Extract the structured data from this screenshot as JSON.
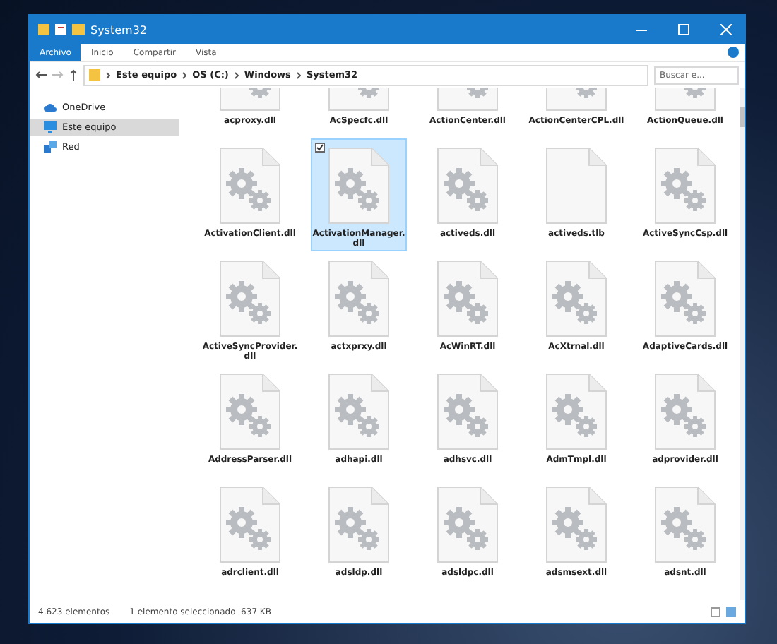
{
  "window": {
    "title": "System32"
  },
  "ribbon_tabs": [
    {
      "label": "Archivo",
      "selected": true
    },
    {
      "label": "Inicio",
      "selected": false
    },
    {
      "label": "Compartir",
      "selected": false
    },
    {
      "label": "Vista",
      "selected": false
    }
  ],
  "breadcrumb": [
    "Este equipo",
    "OS (C:)",
    "Windows",
    "System32"
  ],
  "search": {
    "placeholder": "Buscar e..."
  },
  "sidebar": {
    "items": [
      {
        "label": "OneDrive",
        "kind": "cloud",
        "selected": false
      },
      {
        "label": "Este equipo",
        "kind": "pc",
        "selected": true
      },
      {
        "label": "Red",
        "kind": "network",
        "selected": false
      }
    ]
  },
  "files": [
    {
      "name": "acproxy.dll",
      "kind": "gear",
      "selected": false
    },
    {
      "name": "AcSpecfc.dll",
      "kind": "gear",
      "selected": false
    },
    {
      "name": "ActionCenter.dll",
      "kind": "gear",
      "selected": false
    },
    {
      "name": "ActionCenterCPL.dll",
      "kind": "gear",
      "selected": false
    },
    {
      "name": "ActionQueue.dll",
      "kind": "gear",
      "selected": false
    },
    {
      "name": "ActivationClient.dll",
      "kind": "gear",
      "selected": false
    },
    {
      "name": "ActivationManager.dll",
      "kind": "gear",
      "selected": true
    },
    {
      "name": "activeds.dll",
      "kind": "gear",
      "selected": false
    },
    {
      "name": "activeds.tlb",
      "kind": "blank",
      "selected": false
    },
    {
      "name": "ActiveSyncCsp.dll",
      "kind": "gear",
      "selected": false
    },
    {
      "name": "ActiveSyncProvider.dll",
      "kind": "gear",
      "selected": false
    },
    {
      "name": "actxprxy.dll",
      "kind": "gear",
      "selected": false
    },
    {
      "name": "AcWinRT.dll",
      "kind": "gear",
      "selected": false
    },
    {
      "name": "AcXtrnal.dll",
      "kind": "gear",
      "selected": false
    },
    {
      "name": "AdaptiveCards.dll",
      "kind": "gear",
      "selected": false
    },
    {
      "name": "AddressParser.dll",
      "kind": "gear",
      "selected": false
    },
    {
      "name": "adhapi.dll",
      "kind": "gear",
      "selected": false
    },
    {
      "name": "adhsvc.dll",
      "kind": "gear",
      "selected": false
    },
    {
      "name": "AdmTmpl.dll",
      "kind": "gear",
      "selected": false
    },
    {
      "name": "adprovider.dll",
      "kind": "gear",
      "selected": false
    },
    {
      "name": "adrclient.dll",
      "kind": "gear",
      "selected": false
    },
    {
      "name": "adsldp.dll",
      "kind": "gear",
      "selected": false
    },
    {
      "name": "adsldpc.dll",
      "kind": "gear",
      "selected": false
    },
    {
      "name": "adsmsext.dll",
      "kind": "gear",
      "selected": false
    },
    {
      "name": "adsnt.dll",
      "kind": "gear",
      "selected": false
    }
  ],
  "status_bar": {
    "count": "4.623 elementos",
    "selection": "1 elemento seleccionado  637 KB"
  }
}
